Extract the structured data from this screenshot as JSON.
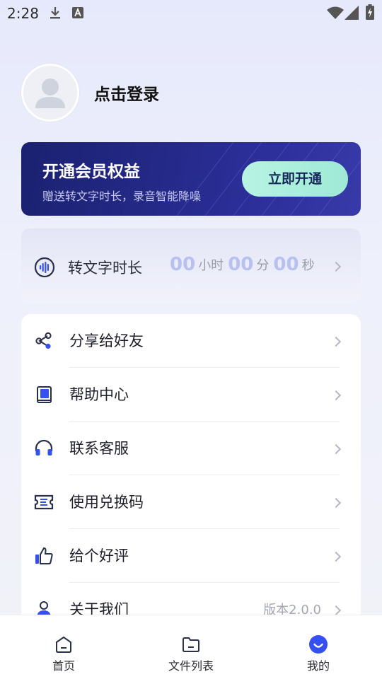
{
  "status_bar": {
    "time": "2:28"
  },
  "profile": {
    "login_text": "点击登录"
  },
  "vip": {
    "title": "开通会员权益",
    "subtitle": "赠送转文字时长，录音智能降噪",
    "button": "立即开通"
  },
  "duration": {
    "label": "转文字时长",
    "hours": "00",
    "hours_unit": "小时",
    "minutes": "00",
    "minutes_unit": "分",
    "seconds": "00",
    "seconds_unit": "秒"
  },
  "menu": [
    {
      "label": "分享给好友",
      "icon": "share-icon"
    },
    {
      "label": "帮助中心",
      "icon": "book-icon"
    },
    {
      "label": "联系客服",
      "icon": "headset-icon"
    },
    {
      "label": "使用兑换码",
      "icon": "ticket-icon"
    },
    {
      "label": "给个好评",
      "icon": "thumbs-up-icon"
    },
    {
      "label": "关于我们",
      "icon": "person-icon",
      "extra": "版本2.0.0"
    }
  ],
  "bottom_nav": [
    {
      "label": "首页",
      "icon": "home-icon"
    },
    {
      "label": "文件列表",
      "icon": "folder-icon"
    },
    {
      "label": "我的",
      "icon": "profile-icon",
      "active": true
    }
  ],
  "colors": {
    "accent": "#3550f0",
    "vip_bg": "#252a8a",
    "vip_button": "#a8eedb",
    "duration_number": "#b7c0ee"
  }
}
